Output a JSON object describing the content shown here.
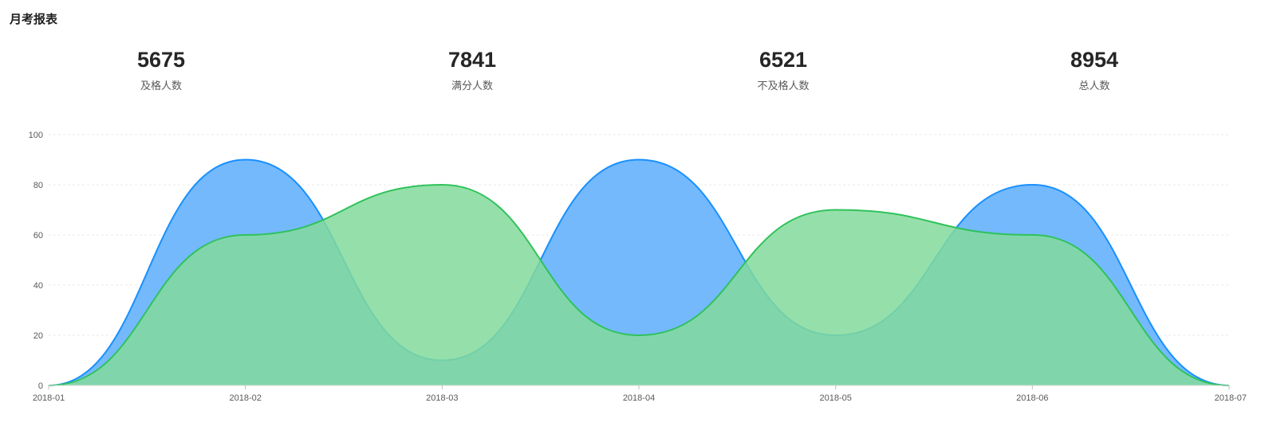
{
  "report": {
    "title": "月考报表"
  },
  "stats": [
    {
      "value": "5675",
      "label": "及格人数"
    },
    {
      "value": "7841",
      "label": "满分人数"
    },
    {
      "value": "6521",
      "label": "不及格人数"
    },
    {
      "value": "8954",
      "label": "总人数"
    }
  ],
  "chart_data": {
    "type": "area",
    "title": "",
    "xlabel": "",
    "ylabel": "",
    "categories": [
      "2018-01",
      "2018-02",
      "2018-03",
      "2018-04",
      "2018-05",
      "2018-06",
      "2018-07"
    ],
    "ylim": [
      0,
      100
    ],
    "yticks": [
      0,
      20,
      40,
      60,
      80,
      100
    ],
    "grid": true,
    "legend": "none",
    "series": [
      {
        "values": [
          0,
          90,
          10,
          90,
          20,
          80,
          0
        ],
        "color": "#1890ff",
        "fill": "#74b9fc"
      },
      {
        "values": [
          0,
          60,
          80,
          20,
          70,
          60,
          0
        ],
        "color": "#2fc25b",
        "fill": "#82db9b"
      }
    ]
  }
}
